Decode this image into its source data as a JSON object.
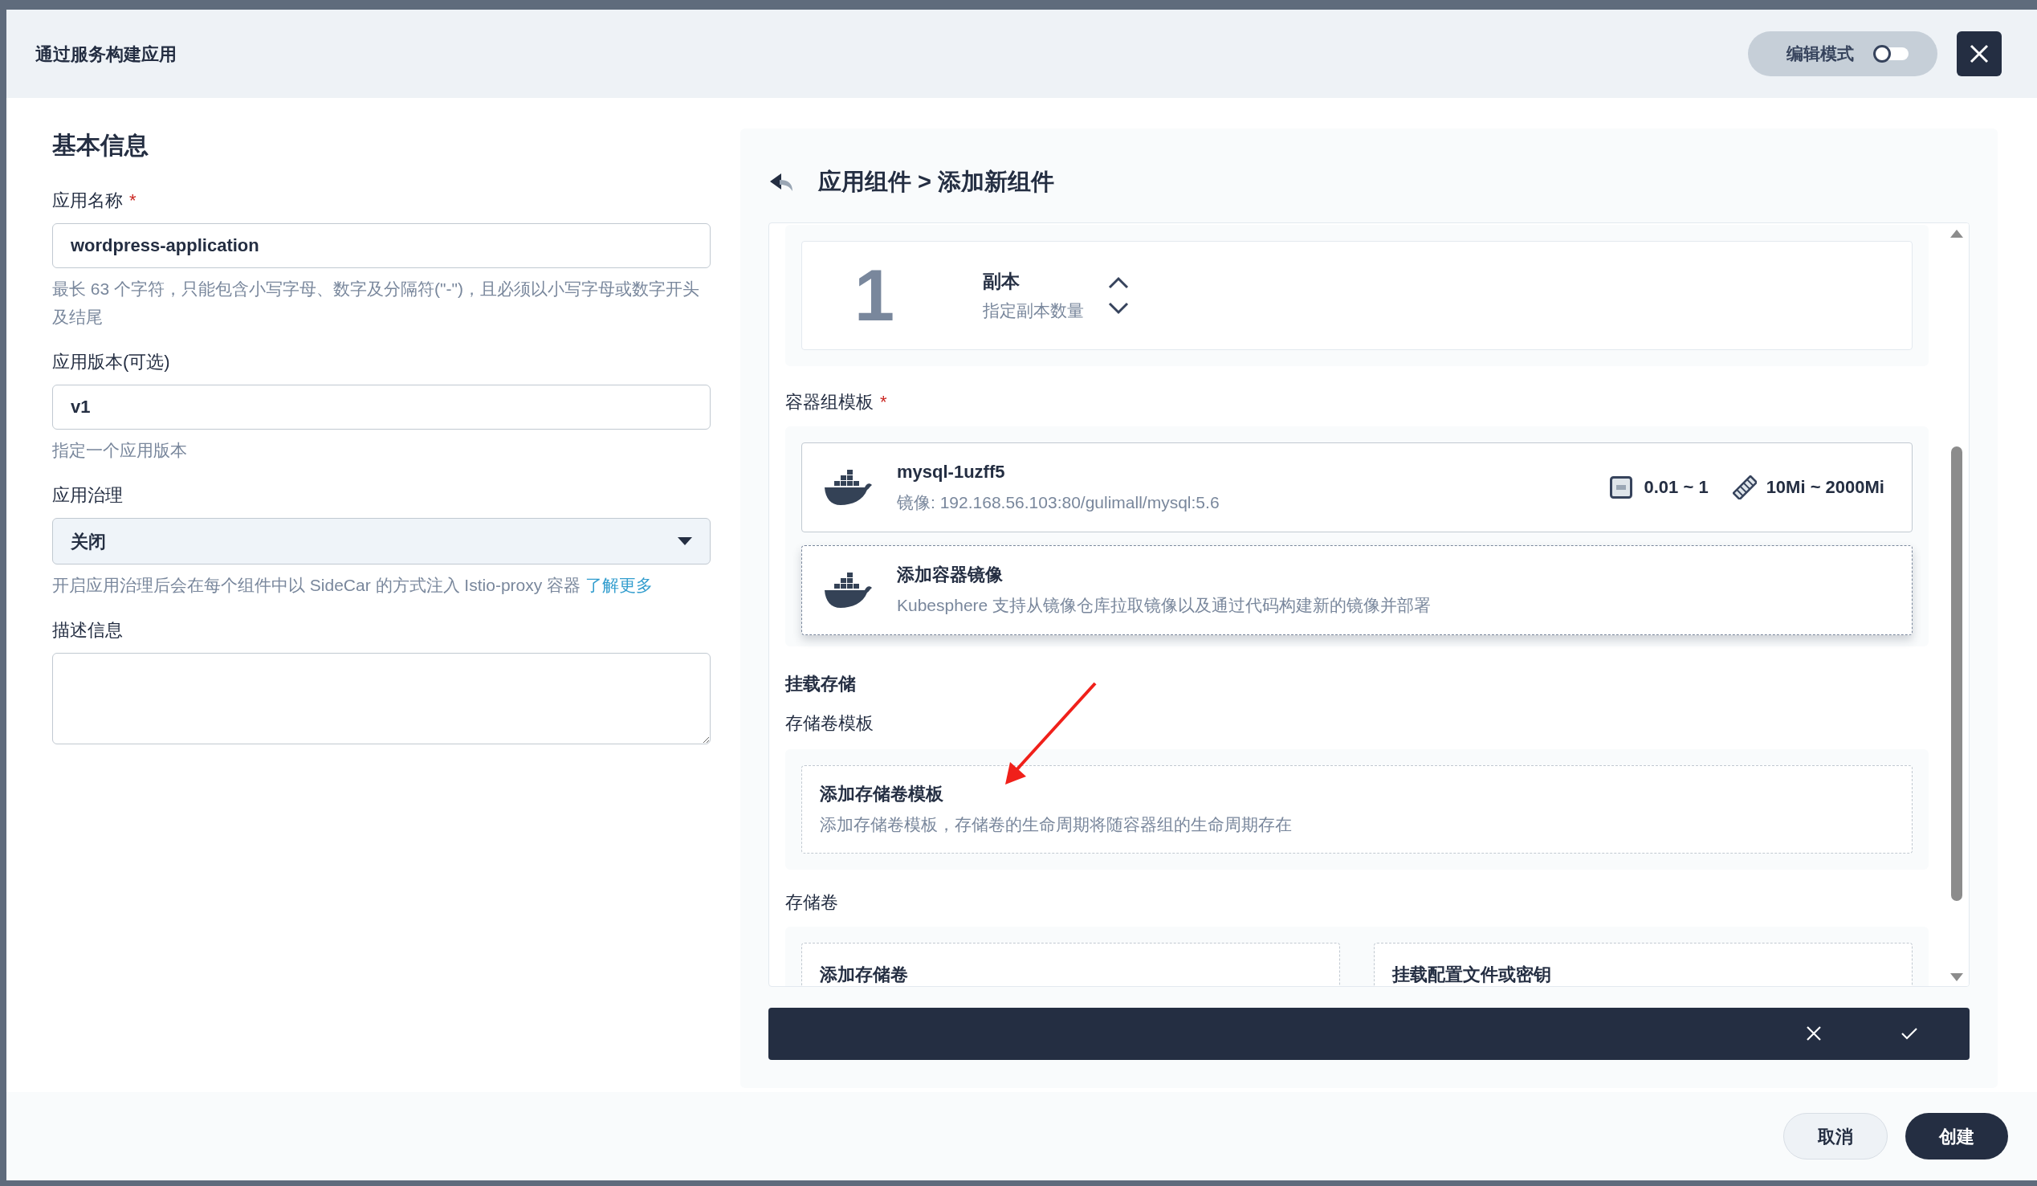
{
  "dialog": {
    "title": "通过服务构建应用",
    "edit_mode": {
      "label": "编辑模式",
      "on": false
    }
  },
  "basic_info": {
    "heading": "基本信息",
    "fields": [
      {
        "kind": "input",
        "label": "应用名称",
        "required_mark": "*",
        "value": "wordpress-application",
        "hint": "最长 63 个字符，只能包含小写字母、数字及分隔符(\"-\")，且必须以小写字母或数字开头及结尾"
      },
      {
        "kind": "input",
        "label": "应用版本(可选)",
        "value": "v1",
        "hint": "指定一个应用版本"
      },
      {
        "kind": "select",
        "label": "应用治理",
        "value": "关闭",
        "hint": "开启应用治理后会在每个组件中以 SideCar 的方式注入 Istio-proxy 容器",
        "hint_link": "了解更多"
      },
      {
        "kind": "textarea",
        "label": "描述信息"
      }
    ]
  },
  "component": {
    "breadcrumb": "应用组件 > 添加新组件",
    "replicas": {
      "count": "1",
      "label": "副本",
      "hint": "指定副本数量"
    },
    "container_template": {
      "label": "容器组模板",
      "required_mark": "*",
      "containers": [
        {
          "name": "mysql-1uzff5",
          "image": "镜像: 192.168.56.103:80/gulimall/mysql:5.6",
          "cpu": "0.01 ~ 1",
          "memory": "10Mi ~ 2000Mi"
        }
      ],
      "add_card": {
        "title": "添加容器镜像",
        "description": "Kubesphere 支持从镜像仓库拉取镜像以及通过代码构建新的镜像并部署"
      }
    },
    "storage": {
      "heading": "挂载存储",
      "volume_template": {
        "label": "存储卷模板",
        "add_card": {
          "title": "添加存储卷模板",
          "description": "添加存储卷模板，存储卷的生命周期将随容器组的生命周期存在"
        }
      },
      "volumes": {
        "label": "存储卷",
        "cards": [
          {
            "title": "添加存储卷"
          },
          {
            "title": "挂载配置文件或密钥"
          }
        ]
      }
    }
  },
  "footer": {
    "cancel": "取消",
    "create": "创建"
  }
}
